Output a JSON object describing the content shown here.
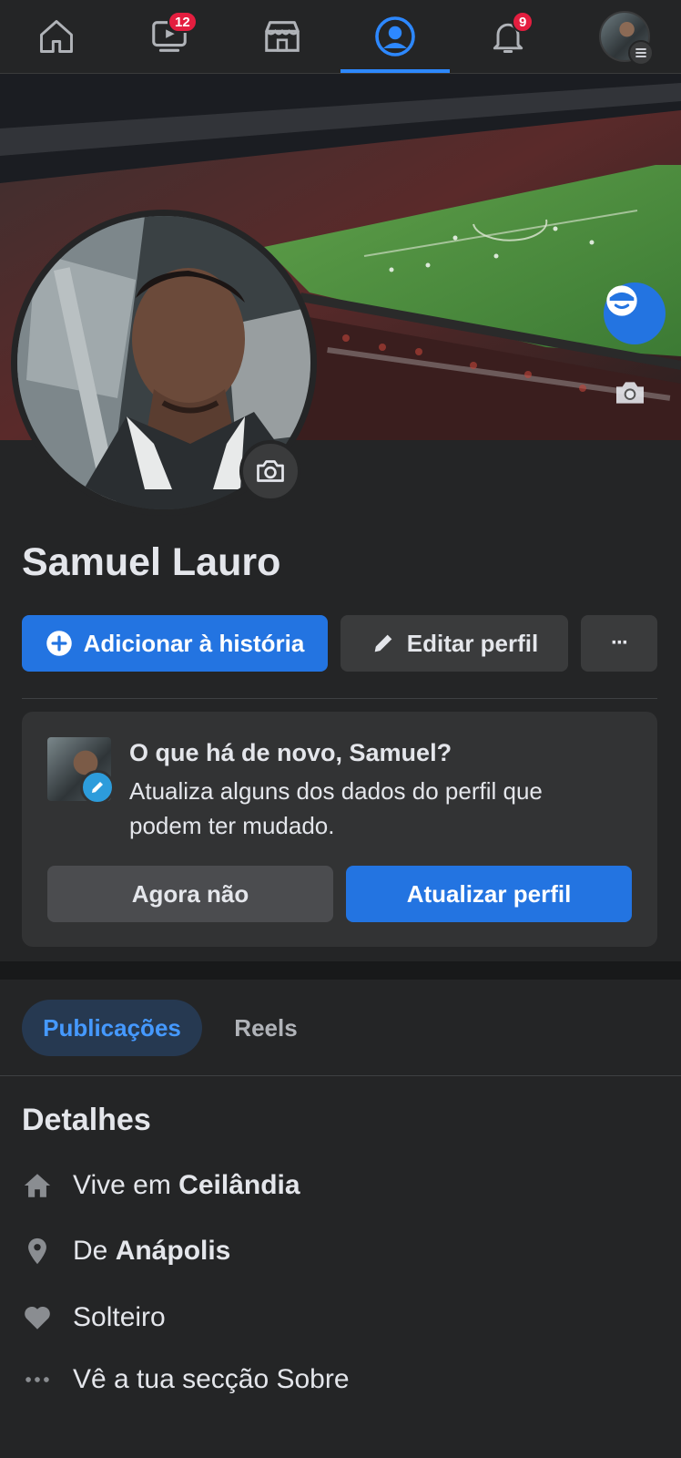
{
  "nav": {
    "items": [
      {
        "name": "home-icon"
      },
      {
        "name": "watch-icon",
        "badge": "12"
      },
      {
        "name": "marketplace-icon"
      },
      {
        "name": "profile-icon",
        "active": true
      },
      {
        "name": "bell-icon",
        "badge": "9"
      },
      {
        "name": "menu-avatar"
      }
    ]
  },
  "profile": {
    "name": "Samuel Lauro"
  },
  "actions": {
    "add_story": "Adicionar à história",
    "edit_profile": "Editar perfil",
    "more": "···"
  },
  "update_card": {
    "title": "O que há de novo, Samuel?",
    "text": "Atualiza alguns dos dados do perfil que podem ter mudado.",
    "dismiss": "Agora não",
    "update": "Atualizar perfil"
  },
  "tabs": {
    "posts": "Publicações",
    "reels": "Reels"
  },
  "details": {
    "title": "Detalhes",
    "lives_prefix": "Vive em ",
    "lives_city": "Ceilândia",
    "from_prefix": "De ",
    "from_city": "Anápolis",
    "relationship": "Solteiro",
    "about_link": "Vê a tua secção Sobre"
  },
  "colors": {
    "accent": "#2374e1",
    "badge": "#e41e3f",
    "background": "#242526"
  }
}
